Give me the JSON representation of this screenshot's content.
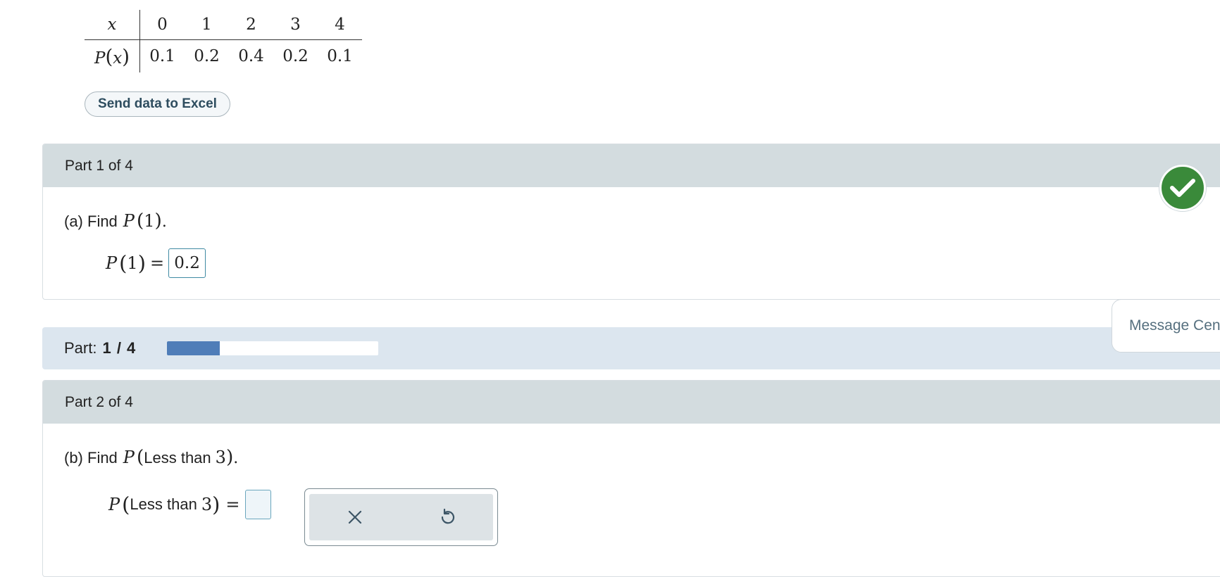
{
  "table": {
    "x_label": "x",
    "p_label": "P",
    "p_arg": "x",
    "x_values": [
      "0",
      "1",
      "2",
      "3",
      "4"
    ],
    "p_values": [
      "0.1",
      "0.2",
      "0.4",
      "0.2",
      "0.1"
    ]
  },
  "excel_button": "Send data to Excel",
  "part1": {
    "header": "Part 1 of 4",
    "question_prefix": "(a) Find",
    "question_func": "P",
    "question_arg": "1",
    "question_suffix": ".",
    "answer_lhs_func": "P",
    "answer_lhs_arg": "1",
    "equals": "=",
    "answer_value": "0.2",
    "status": "correct"
  },
  "progress": {
    "label": "Part:",
    "value": "1 / 4",
    "fraction": 0.25
  },
  "message_center": "Message Center",
  "part2": {
    "header": "Part 2 of 4",
    "question_prefix": "(b) Find",
    "question_func": "P",
    "question_text": "Less than",
    "question_num": "3",
    "question_suffix": ".",
    "answer_lhs_func": "P",
    "answer_lhs_text": "Less than",
    "answer_lhs_num": "3",
    "equals": "=",
    "answer_value": ""
  },
  "tools": {
    "clear_icon": "close-icon",
    "reset_icon": "undo-icon"
  },
  "colors": {
    "part_header_bg": "#d3dcdf",
    "progress_strip_bg": "#dce6ef",
    "progress_fill": "#4f7db8",
    "check_green": "#3a8a3a",
    "answer_border": "#3f8aa3"
  }
}
